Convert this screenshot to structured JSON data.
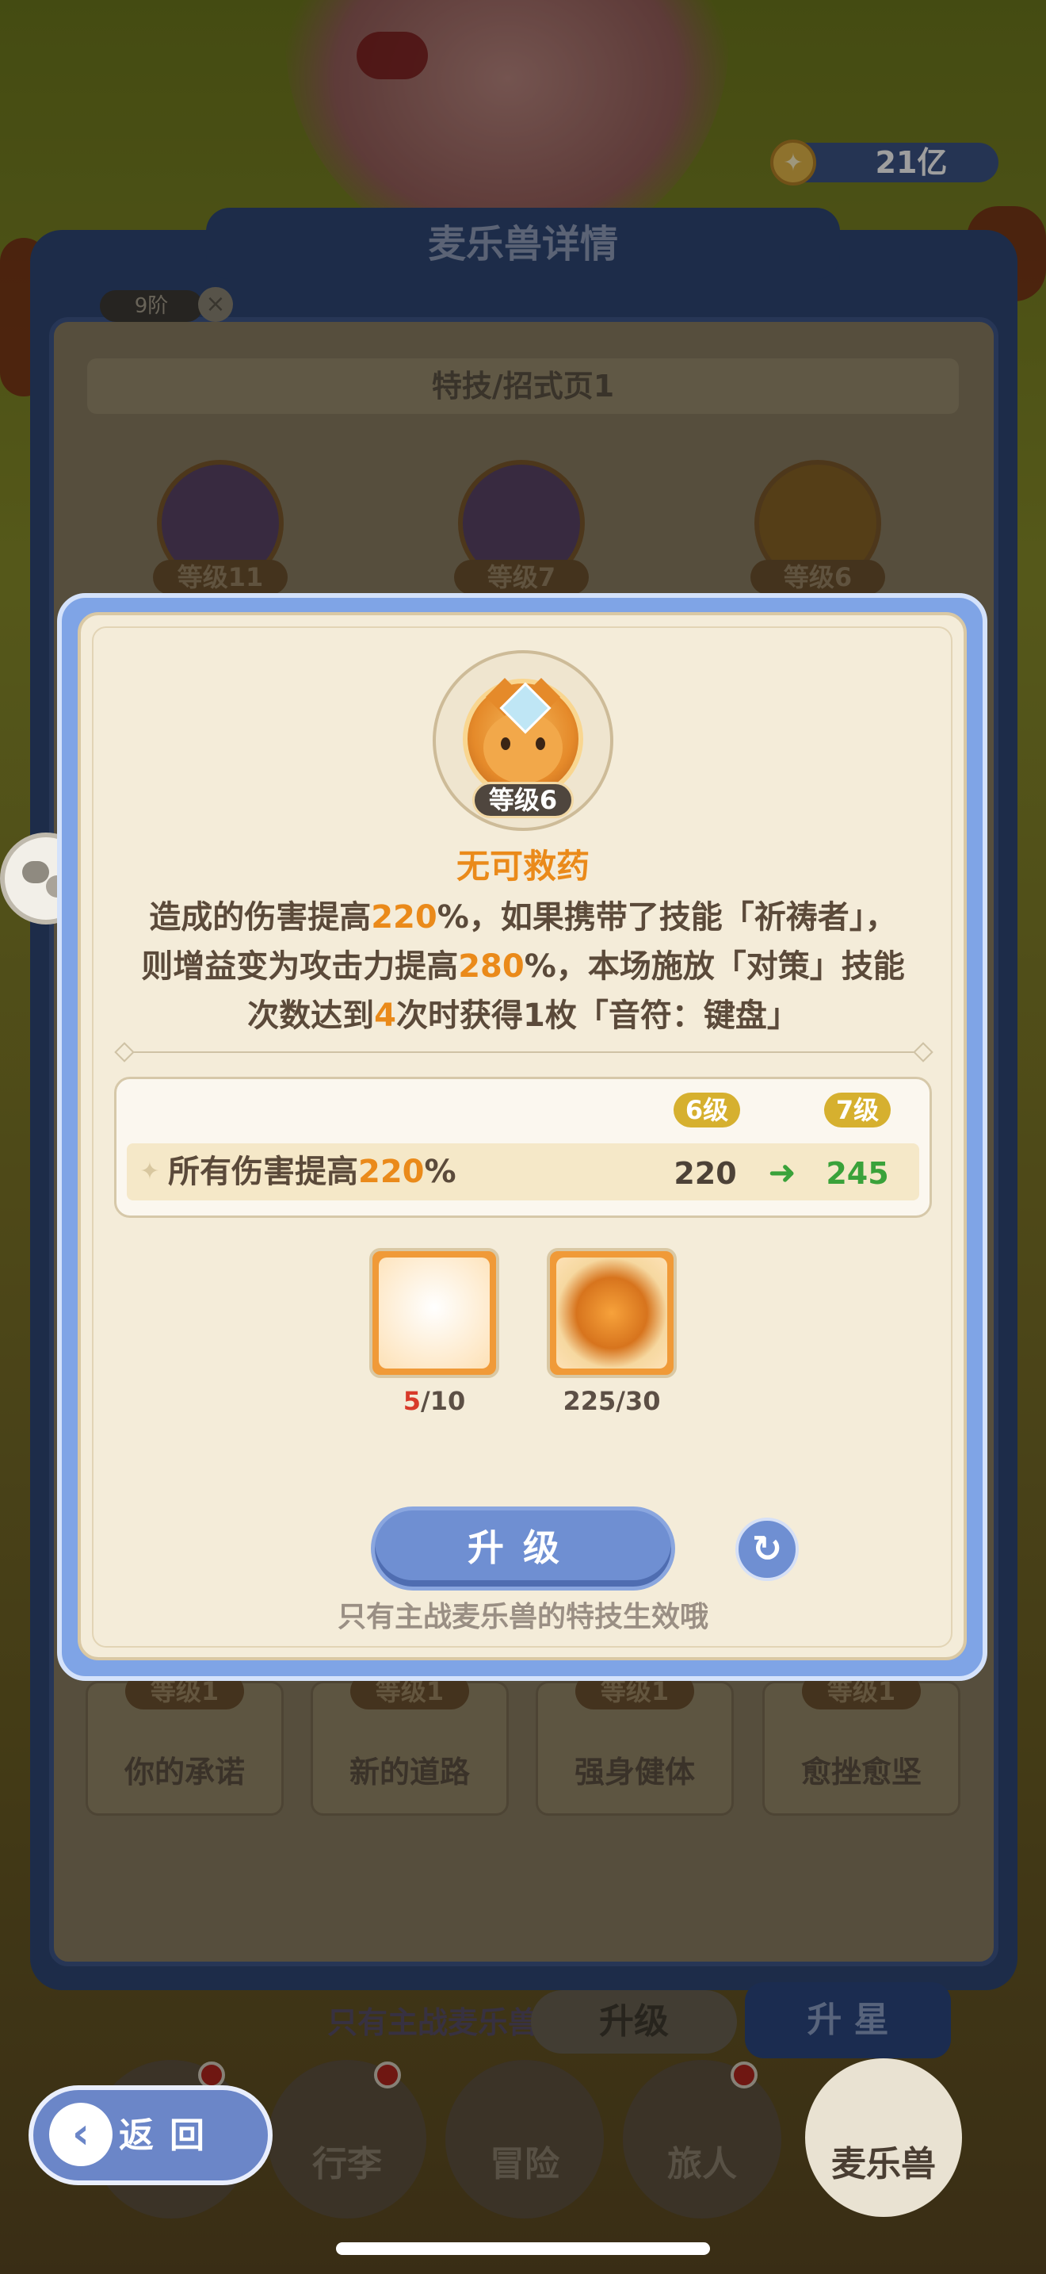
{
  "currency": {
    "icon": "gold-coin-icon",
    "amount": "21亿"
  },
  "background": {
    "title": "麦乐兽详情",
    "stage_badge": "9阶",
    "subtitle": "特技/招式页1",
    "skill_levels": [
      "等级11",
      "等级7",
      "等级6"
    ],
    "cards": [
      {
        "level": "等级1",
        "name": "你的承诺"
      },
      {
        "level": "等级1",
        "name": "新的道路"
      },
      {
        "level": "等级1",
        "name": "强身健体"
      },
      {
        "level": "等级1",
        "name": "愈挫愈坚"
      }
    ],
    "footer_note": "只有主战麦乐兽的特技生效哦",
    "upgrade_label": "升级",
    "star_label": "升 星"
  },
  "modal": {
    "skill_level": "等级6",
    "skill_name": "无可救药",
    "desc": {
      "l1a": "造成的伤害提高",
      "l1v": "220",
      "l1b": "%，如果携带了技能「祈祷者」，",
      "l2a": "则增益变为攻击力提高",
      "l2v": "280",
      "l2b": "%，本场施放「对策」技能",
      "l3a": "次数达到",
      "l3v": "4",
      "l3b": "次时获得1枚「音符：键盘」"
    },
    "levels": {
      "current": "6级",
      "next": "7级"
    },
    "stat": {
      "label": "所有伤害提高",
      "label_value": "220",
      "label_unit": "%",
      "old": "220",
      "new": "245"
    },
    "items": [
      {
        "icon": "duck-token-icon",
        "have": "5",
        "need": "/10"
      },
      {
        "icon": "gold-medal-icon",
        "have": "225",
        "need": "/30"
      }
    ],
    "upgrade_button": "升级",
    "note": "只有主战麦乐兽的特技生效哦"
  },
  "nav": {
    "back_label": "返回",
    "tabs": [
      "行李",
      "冒险",
      "旅人",
      "麦乐兽"
    ]
  },
  "colors": {
    "accent": "#ea8a1a",
    "button_blue": "#6f8fd2",
    "success": "#3aa23a",
    "alert": "#d83a2a"
  }
}
